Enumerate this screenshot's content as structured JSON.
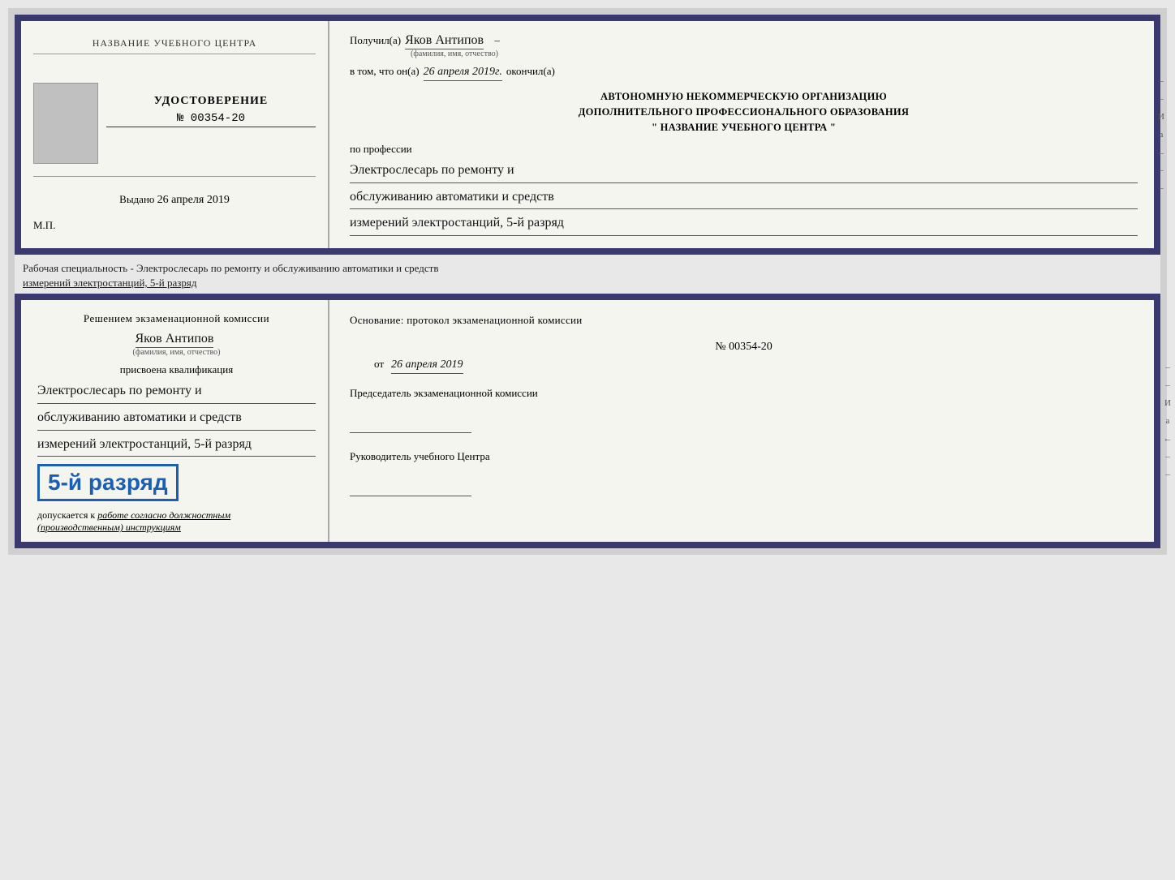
{
  "top_cert": {
    "left": {
      "org_name": "НАЗВАНИЕ УЧЕБНОГО ЦЕНТРА",
      "udostoverenie_title": "УДОСТОВЕРЕНИЕ",
      "cert_number": "№ 00354-20",
      "vudano_label": "Выдано",
      "vudano_date": "26 апреля 2019",
      "mp_label": "М.П."
    },
    "right": {
      "poluchil_label": "Получил(а)",
      "recipient_name": "Яков Антипов",
      "fio_hint": "(фамилия, имя, отчество)",
      "vtom_label": "в том, что он(а)",
      "date_value": "26 апреля 2019г.",
      "okonchil_label": "окончил(а)",
      "org_line1": "АВТОНОМНУЮ НЕКОММЕРЧЕСКУЮ ОРГАНИЗАЦИЮ",
      "org_line2": "ДОПОЛНИТЕЛЬНОГО ПРОФЕССИОНАЛЬНОГО ОБРАЗОВАНИЯ",
      "org_line3": "\"  НАЗВАНИЕ УЧЕБНОГО ЦЕНТРА  \"",
      "po_professii_label": "по профессии",
      "profession_line1": "Электрослесарь по ремонту и",
      "profession_line2": "обслуживанию автоматики и средств",
      "profession_line3": "измерений электростанций, 5-й разряд"
    }
  },
  "middle": {
    "text_prefix": "Рабочая специальность - Электрослесарь по ремонту и обслуживанию автоматики и средств",
    "text_suffix": "измерений электростанций, 5-й разряд"
  },
  "bottom_cert": {
    "left": {
      "resheniem_label": "Решением экзаменационной комиссии",
      "fio_name": "Яков Антипов",
      "fio_hint": "(фамилия, имя, отчество)",
      "prisvoena_label": "присвоена квалификация",
      "qual_line1": "Электрослесарь по ремонту и",
      "qual_line2": "обслуживанию автоматики и средств",
      "qual_line3": "измерений электростанций, 5-й разряд",
      "razryad_stamp": "5-й разряд",
      "dopuskaetsya_label": "допускается к",
      "dopusk_text": "работе согласно должностным (производственным) инструкциям"
    },
    "right": {
      "osnovanie_label": "Основание: протокол экзаменационной комиссии",
      "protocol_number": "№ 00354-20",
      "ot_label": "от",
      "ot_date": "26 апреля 2019",
      "predsedatel_title": "Председатель экзаменационной комиссии",
      "rukovoditel_title": "Руководитель учебного Центра"
    }
  },
  "side_chars": {
    "items": [
      "И",
      "а",
      "←",
      "–",
      "–",
      "–",
      "–"
    ]
  }
}
